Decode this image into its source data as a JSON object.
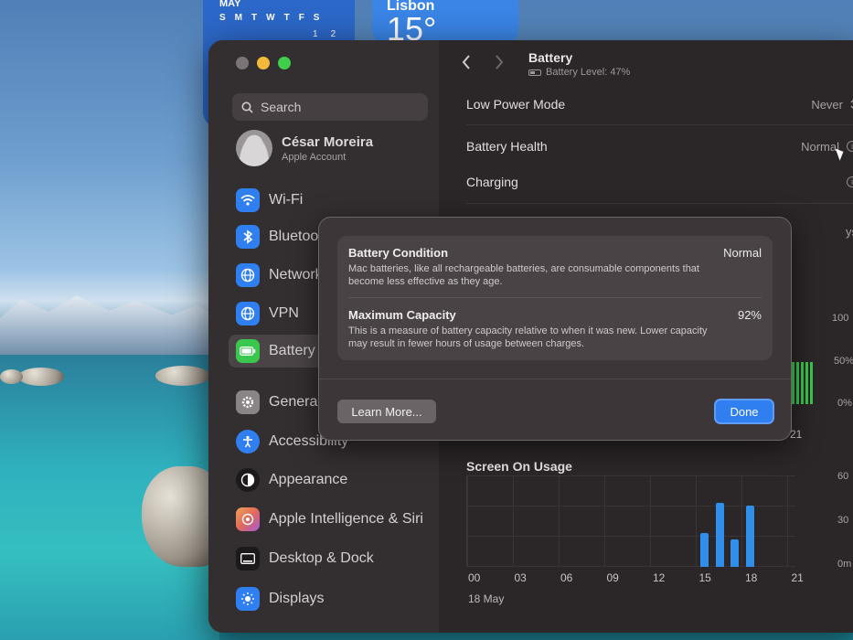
{
  "desktop": {
    "calendar_widget": {
      "month": "MAY",
      "weekdays": [
        "S",
        "M",
        "T",
        "W",
        "T",
        "F",
        "S"
      ],
      "visible_days": [
        "1",
        "2"
      ]
    },
    "weather_widget": {
      "city": "Lisbon",
      "temperature": "15°"
    }
  },
  "window": {
    "title": "Battery",
    "subtitle": "Battery Level: 47%"
  },
  "sidebar": {
    "search_placeholder": "Search",
    "account": {
      "name": "César Moreira",
      "subtitle": "Apple Account"
    },
    "items": [
      {
        "label": "Wi-Fi",
        "icon": "wifi-icon",
        "color": "#2f7ff0"
      },
      {
        "label": "Bluetooth",
        "icon": "bluetooth-icon",
        "color": "#2f7ff0"
      },
      {
        "label": "Network",
        "icon": "globe-icon",
        "color": "#2f7ff0"
      },
      {
        "label": "VPN",
        "icon": "globe-icon",
        "color": "#2f7ff0"
      },
      {
        "label": "Battery",
        "icon": "battery-icon",
        "color": "#39c74e",
        "active": true
      },
      {
        "label": "General",
        "icon": "gear-icon",
        "color": "#8a8486"
      },
      {
        "label": "Accessibility",
        "icon": "accessibility-icon",
        "color": "#2f7ff0"
      },
      {
        "label": "Appearance",
        "icon": "appearance-icon",
        "color": "#1c1a1b"
      },
      {
        "label": "Apple Intelligence & Siri",
        "icon": "siri-icon",
        "color": "#e0695a"
      },
      {
        "label": "Desktop & Dock",
        "icon": "dock-icon",
        "color": "#1c1a1b"
      },
      {
        "label": "Displays",
        "icon": "sun-icon",
        "color": "#2f7ff0"
      }
    ]
  },
  "settings": {
    "low_power_mode": {
      "label": "Low Power Mode",
      "value": "Never"
    },
    "battery_health": {
      "label": "Battery Health",
      "value": "Normal"
    },
    "charging": {
      "label": "Charging"
    },
    "partial_text": "ys"
  },
  "charts": {
    "battery_level_y_ticks": [
      "100",
      "50%",
      "0%"
    ],
    "battery_x_tick": "21",
    "screen_on_title": "Screen On Usage",
    "screen_on_y_ticks": [
      "60",
      "30",
      "0m"
    ],
    "x_ticks": [
      "00",
      "03",
      "06",
      "09",
      "12",
      "15",
      "18",
      "21"
    ],
    "date": "18 May"
  },
  "sheet": {
    "battery_condition": {
      "title": "Battery Condition",
      "value": "Normal",
      "description": "Mac batteries, like all rechargeable batteries, are consumable components that become less effective as they age."
    },
    "maximum_capacity": {
      "title": "Maximum Capacity",
      "value": "92%",
      "description": "This is a measure of battery capacity relative to when it was new. Lower capacity may result in fewer hours of usage between charges."
    },
    "learn_more_label": "Learn More...",
    "done_label": "Done"
  },
  "chart_data": {
    "type": "bar",
    "title": "Screen On Usage",
    "categories": [
      "15",
      "16",
      "17",
      "18"
    ],
    "values": [
      22,
      42,
      18,
      40
    ],
    "ylim": [
      0,
      60
    ],
    "x_ticks": [
      "00",
      "03",
      "06",
      "09",
      "12",
      "15",
      "18",
      "21"
    ],
    "xlabel": "18 May",
    "grid": true
  }
}
